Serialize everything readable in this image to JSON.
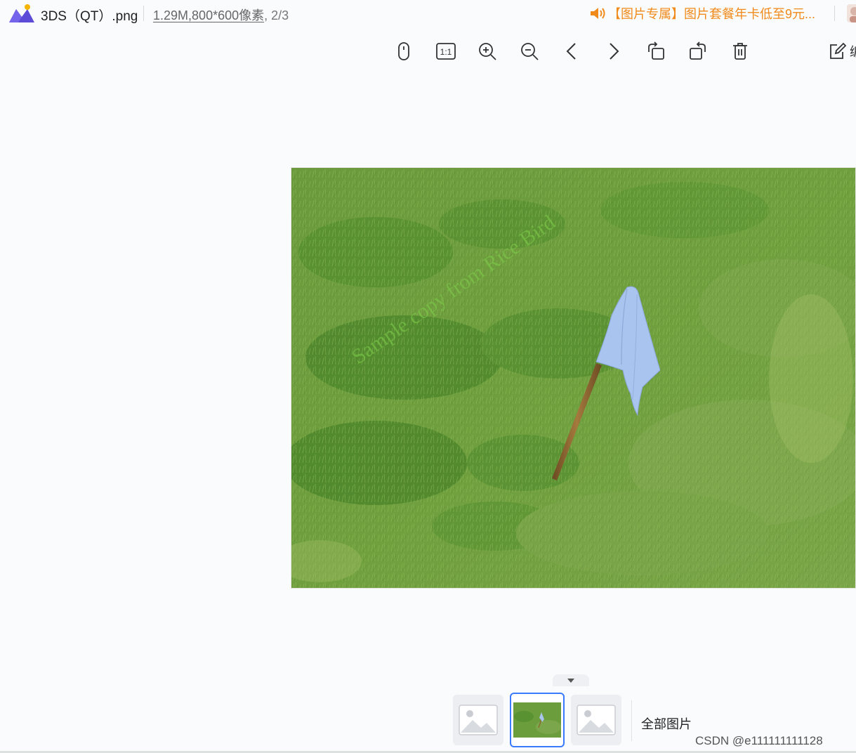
{
  "titlebar": {
    "file_name": "3DS（QT）.png",
    "file_size": "1.29M",
    "dimensions": "800*600像素",
    "position": ", 2/3",
    "promo_text": "【图片专属】图片套餐年卡低至9元...",
    "icons": {
      "logo": "app-logo-icon",
      "speaker": "speaker-icon",
      "avatar": "avatar"
    }
  },
  "toolbar": {
    "buttons": [
      {
        "name": "mouse-mode",
        "icon": "mouse-icon"
      },
      {
        "name": "actual-size",
        "icon": "one-to-one-icon",
        "label": "1:1"
      },
      {
        "name": "zoom-in",
        "icon": "zoom-in-icon"
      },
      {
        "name": "zoom-out",
        "icon": "zoom-out-icon"
      },
      {
        "name": "previous",
        "icon": "chevron-left-icon"
      },
      {
        "name": "next",
        "icon": "chevron-right-icon"
      },
      {
        "name": "rotate-left",
        "icon": "rotate-left-icon"
      },
      {
        "name": "rotate-right",
        "icon": "rotate-right-icon"
      },
      {
        "name": "delete",
        "icon": "trash-icon"
      },
      {
        "name": "edit",
        "icon": "edit-icon"
      }
    ],
    "edit_label": "编"
  },
  "viewer": {
    "image_watermark": "Sample copy from Rice Bird"
  },
  "strip": {
    "all_images_label": "全部图片",
    "active_index": 1,
    "thumbnails": [
      {
        "type": "placeholder",
        "icon": "image-placeholder-icon"
      },
      {
        "type": "photo",
        "icon": "grass-flag-thumbnail"
      },
      {
        "type": "placeholder",
        "icon": "image-placeholder-icon"
      }
    ]
  },
  "footer": {
    "watermark": "CSDN @e111111111128"
  },
  "colors": {
    "accent": "#3a7bfd",
    "promo": "#f08a1a",
    "logo_purple": "#5b4bd6",
    "logo_yellow": "#f5b400",
    "background": "#fafbfd"
  }
}
